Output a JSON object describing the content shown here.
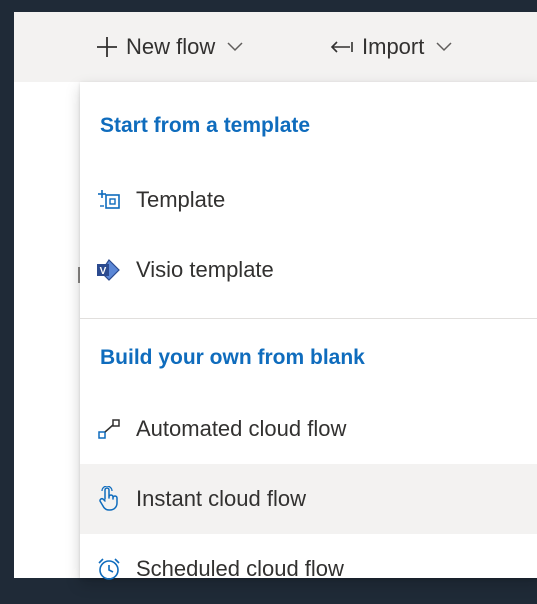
{
  "command_bar": {
    "new_flow_label": "New flow",
    "new_flow_icon": "plus-icon",
    "import_label": "Import",
    "import_icon": "import-arrow-icon"
  },
  "menu": {
    "sections": [
      {
        "header": "Start from a template",
        "items": [
          {
            "label": "Template",
            "icon": "template-icon"
          },
          {
            "label": "Visio template",
            "icon": "visio-icon"
          }
        ]
      },
      {
        "header": "Build your own from blank",
        "items": [
          {
            "label": "Automated cloud flow",
            "icon": "automated-flow-icon"
          },
          {
            "label": "Instant cloud flow",
            "icon": "instant-flow-icon",
            "state": "hovered"
          },
          {
            "label": "Scheduled cloud flow",
            "icon": "scheduled-flow-icon"
          }
        ]
      }
    ]
  },
  "colors": {
    "header_blue": "#0f6cbd",
    "text": "#323130",
    "command_bar_bg": "#f3f2f1",
    "frame_dark": "#1f2a37",
    "hover_bg": "#f3f2f1",
    "visio_blue": "#3955a3"
  }
}
